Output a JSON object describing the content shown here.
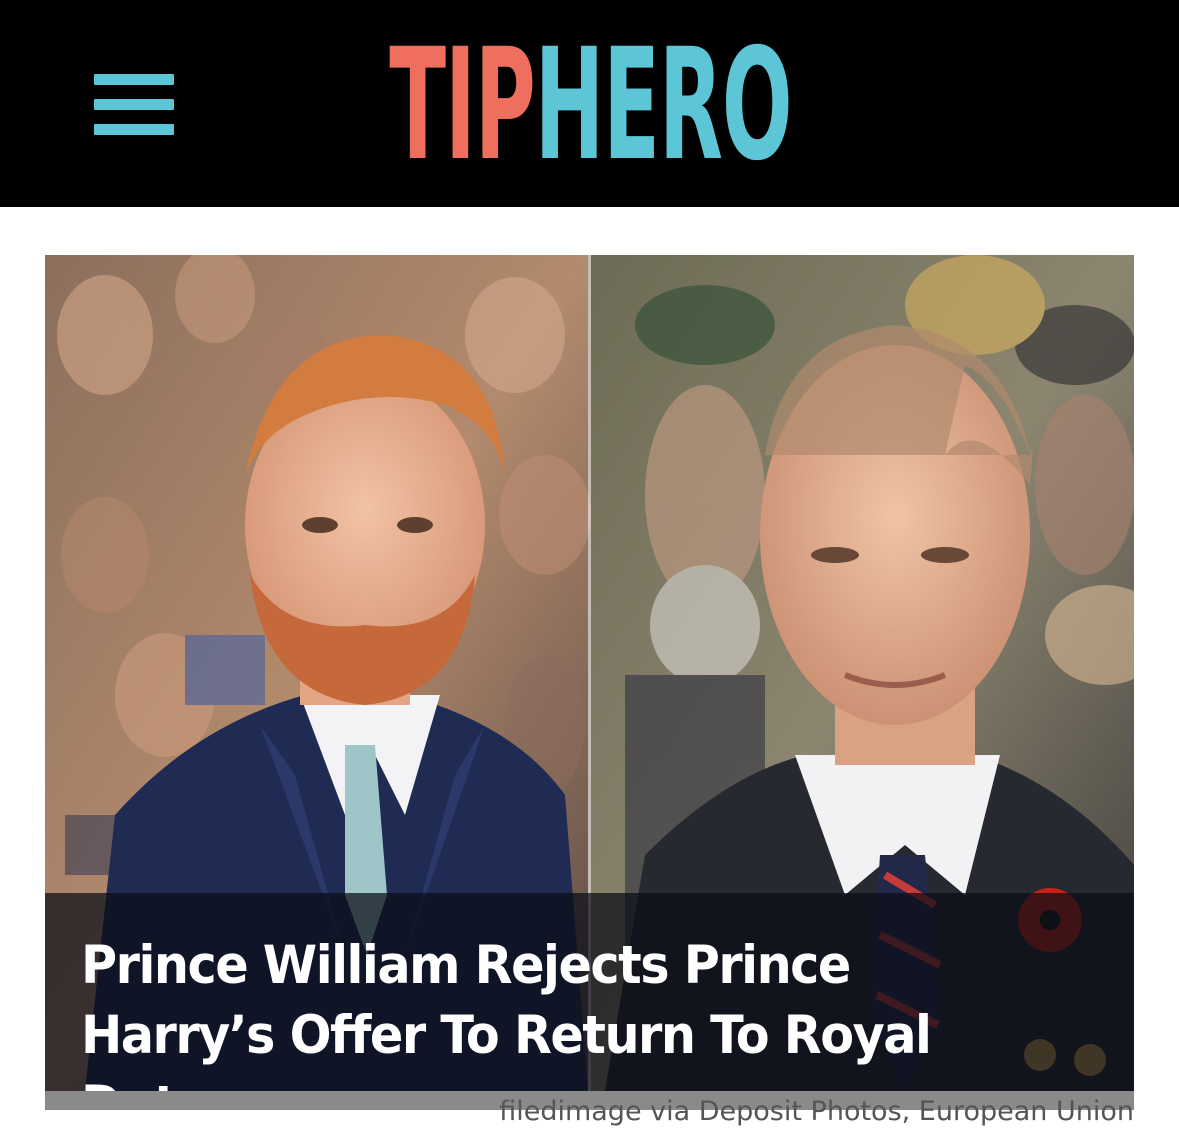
{
  "header": {
    "background": "#000000",
    "menu_icon": "hamburger-menu-icon",
    "logo": {
      "tip": "TIP",
      "hero": "HERO",
      "tip_color": "#ee6f5e",
      "hero_color": "#5cc6d6"
    }
  },
  "article": {
    "image_left_subject": "man with red beard in navy suit and light blue tie",
    "image_right_subject": "bald man in dark suit with striped tie and red poppy",
    "headline": "Prince William Rejects Prince Harry’s Offer To Return To Royal Duty",
    "image_credit": "filedimage via Deposit Photos, European Union"
  }
}
